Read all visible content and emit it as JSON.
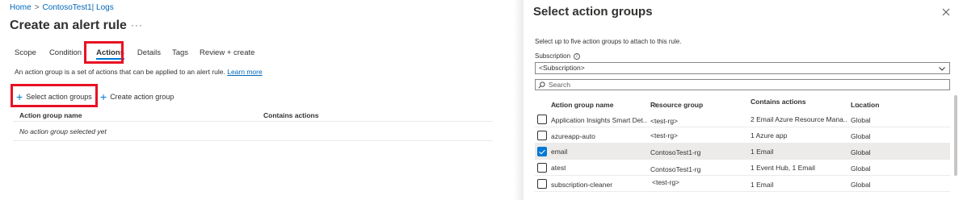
{
  "breadcrumb": {
    "home": "Home",
    "resource": "ContosoTest1| Logs"
  },
  "page": {
    "title": "Create an alert rule",
    "more": "···"
  },
  "tabs": [
    {
      "label": "Scope"
    },
    {
      "label": "Condition"
    },
    {
      "label": "Actions"
    },
    {
      "label": "Details"
    },
    {
      "label": "Tags"
    },
    {
      "label": "Review + create"
    }
  ],
  "description": {
    "text": "An action group is a set of actions that can be applied to an alert rule.",
    "link": "Learn more"
  },
  "commands": {
    "select": "Select action groups",
    "create": "Create action group"
  },
  "left_table": {
    "columns": [
      "Action group name",
      "Contains actions"
    ],
    "empty": "No action group selected yet"
  },
  "panel": {
    "title": "Select action groups",
    "subtitle": "Select up to five action groups to attach to this rule.",
    "subscription_label": "Subscription",
    "subscription_value": "<Subscription>",
    "search_placeholder": "Search",
    "columns": [
      "Action group name",
      "Resource group",
      "Contains actions",
      "Location"
    ],
    "sort_glyph": "↑↓",
    "rows": [
      {
        "name": "Application Insights Smart Det...",
        "rg": "<test-rg>",
        "actions": "2 Email Azure Resource Mana...",
        "location": "Global",
        "checked": false
      },
      {
        "name": "azureapp-auto",
        "rg": "<test-rg>",
        "actions": "1 Azure app",
        "location": "Global",
        "checked": false
      },
      {
        "name": "email",
        "rg": "ContosoTest1-rg",
        "actions": "1 Email",
        "location": "Global",
        "checked": true
      },
      {
        "name": "atest",
        "rg": "ContosoTest1-rg",
        "actions": "1 Event Hub, 1 Email",
        "location": "Global",
        "checked": false
      },
      {
        "name": "subscription-cleaner",
        "rg": "<test-rg>",
        "actions": "1 Email",
        "location": "Global",
        "checked": false
      }
    ]
  },
  "colors": {
    "accent": "#0078d4",
    "highlight": "#e81123",
    "link": "#0067b8",
    "selected_row": "#edebe9"
  }
}
